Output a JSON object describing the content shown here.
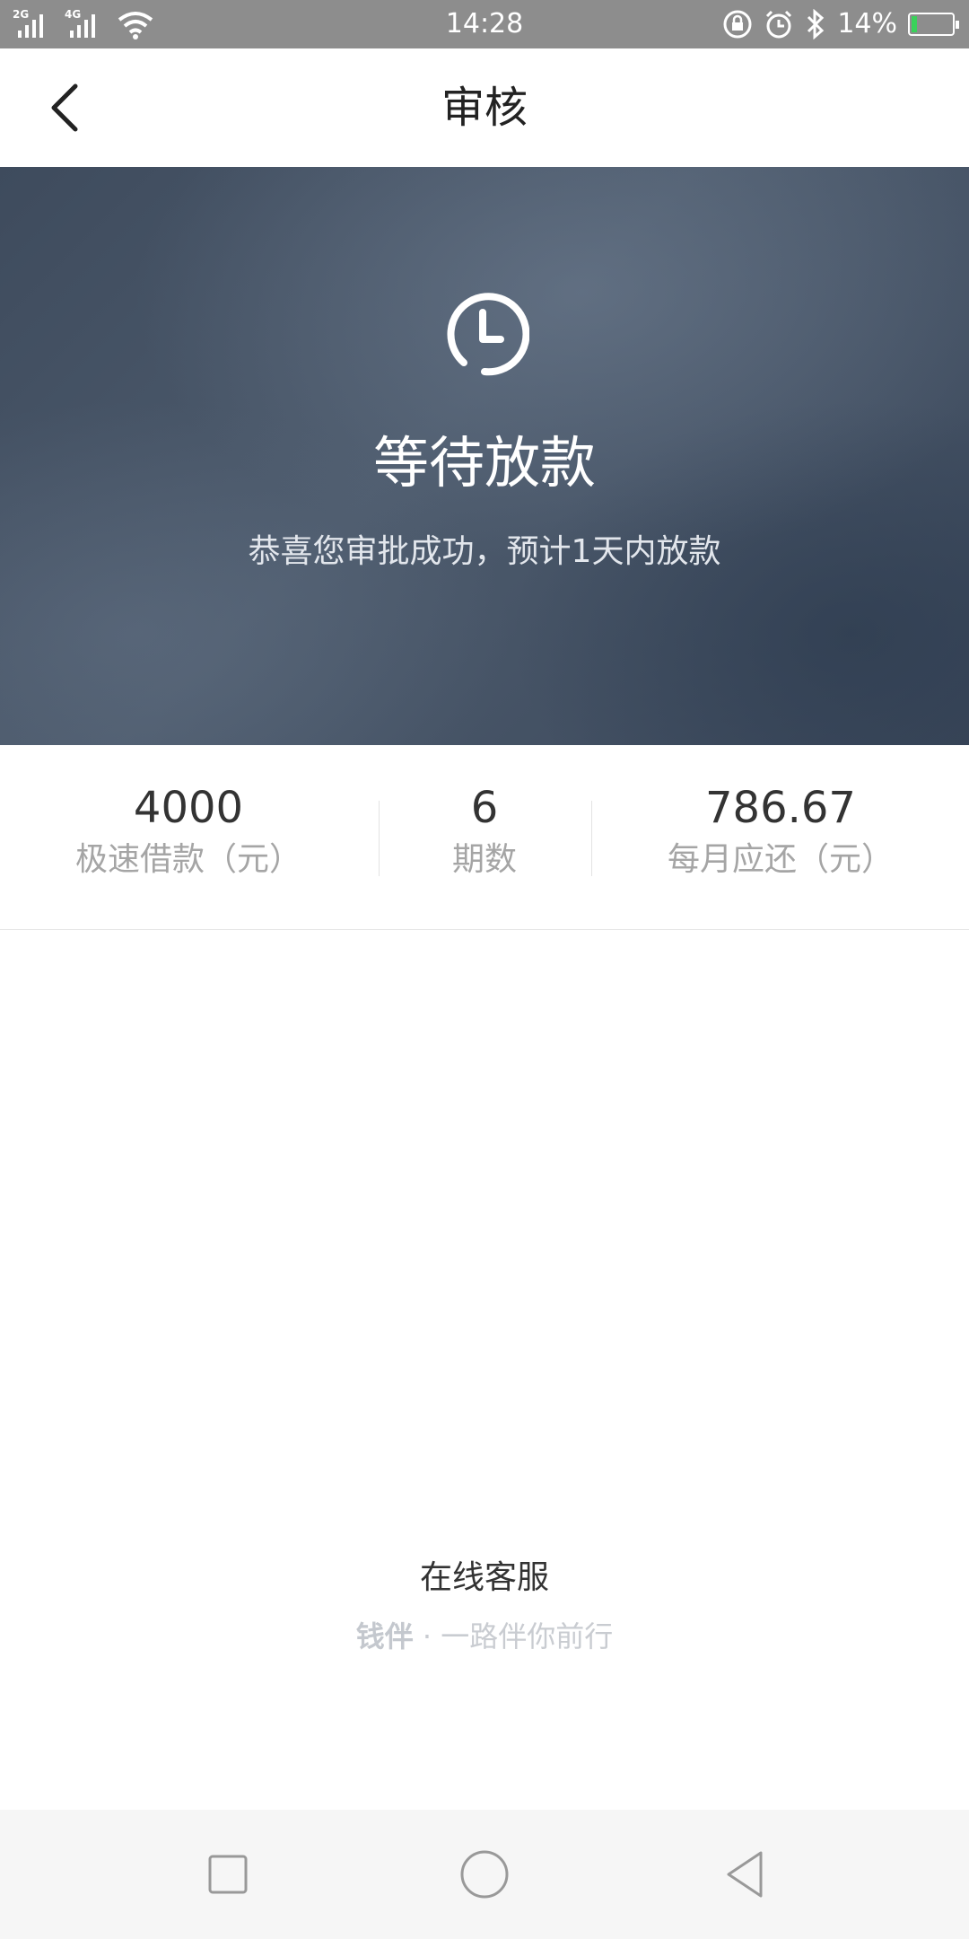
{
  "status_bar": {
    "network_1": "2G",
    "network_2": "4G",
    "time": "14:28",
    "battery_percent": "14%",
    "battery_level": 0.14
  },
  "header": {
    "title": "审核",
    "back_icon": "back-arrow-icon"
  },
  "hero": {
    "icon": "clock-icon",
    "title": "等待放款",
    "subtitle": "恭喜您审批成功，预计1天内放款"
  },
  "summary": {
    "items": [
      {
        "value": "4000",
        "label": "极速借款（元）"
      },
      {
        "value": "6",
        "label": "期数"
      },
      {
        "value": "786.67",
        "label": "每月应还（元）"
      }
    ]
  },
  "footer": {
    "service_link": "在线客服",
    "brand": "钱伴",
    "slogan": "· 一路伴你前行"
  },
  "nav_bar": {
    "recent_icon": "square-icon",
    "home_icon": "circle-icon",
    "back_icon": "triangle-back-icon"
  },
  "colors": {
    "status_bar": "#8d8d8d",
    "hero_bg": "#44516a",
    "accent_battery": "#3ad15a"
  }
}
